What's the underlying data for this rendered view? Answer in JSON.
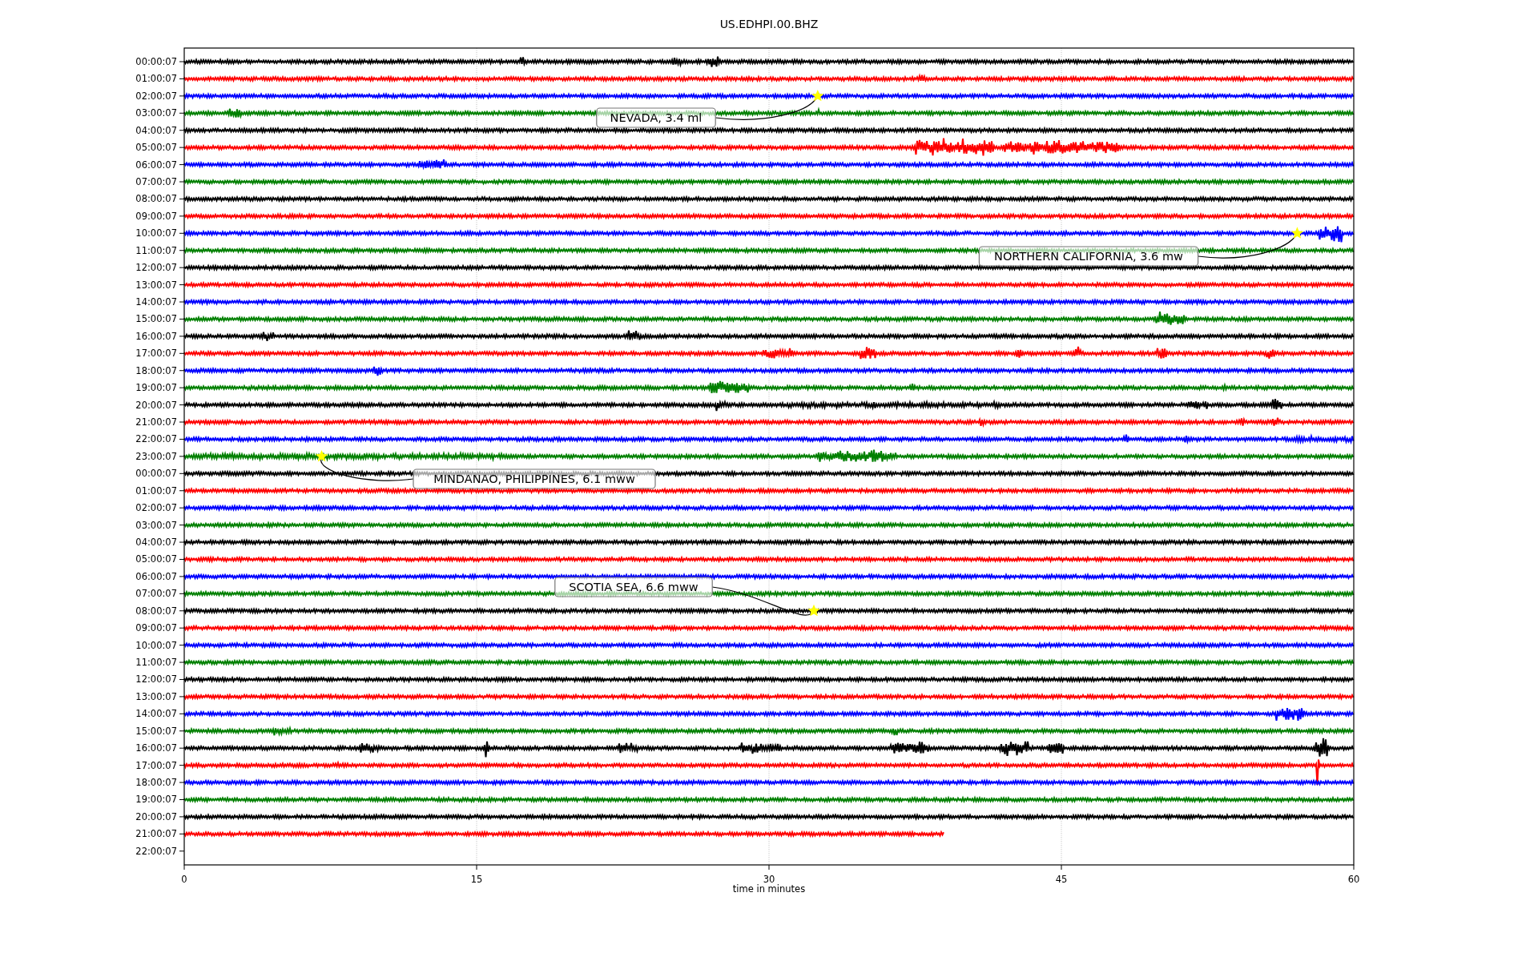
{
  "title": "US.EDHPI.00.BHZ",
  "rows": [
    {
      "label": "00:00:07",
      "color": "#000000",
      "level": 1
    },
    {
      "label": "01:00:07",
      "color": "#ff0000",
      "level": 1
    },
    {
      "label": "02:00:07",
      "color": "#0000ff",
      "level": 1,
      "event": {
        "label": "NEVADA, 3.4 ml"
      }
    },
    {
      "label": "03:00:07",
      "color": "#008000",
      "level": 1
    },
    {
      "label": "04:00:07",
      "color": "#000000",
      "level": 1
    },
    {
      "label": "05:00:07",
      "color": "#ff0000",
      "level": 1
    },
    {
      "label": "06:00:07",
      "color": "#0000ff",
      "level": 1
    },
    {
      "label": "07:00:07",
      "color": "#008000",
      "level": 1
    },
    {
      "label": "08:00:07",
      "color": "#000000",
      "level": 1
    },
    {
      "label": "09:00:07",
      "color": "#ff0000",
      "level": 1
    },
    {
      "label": "10:00:07",
      "color": "#0000ff",
      "level": 1,
      "event": {
        "label": "NORTHERN CALIFORNIA, 3.6 mw"
      }
    },
    {
      "label": "11:00:07",
      "color": "#008000",
      "level": 1
    },
    {
      "label": "12:00:07",
      "color": "#000000",
      "level": 1
    },
    {
      "label": "13:00:07",
      "color": "#ff0000",
      "level": 1
    },
    {
      "label": "14:00:07",
      "color": "#0000ff",
      "level": 1
    },
    {
      "label": "15:00:07",
      "color": "#008000",
      "level": 1
    },
    {
      "label": "16:00:07",
      "color": "#000000",
      "level": 1
    },
    {
      "label": "17:00:07",
      "color": "#ff0000",
      "level": 1
    },
    {
      "label": "18:00:07",
      "color": "#0000ff",
      "level": 1
    },
    {
      "label": "19:00:07",
      "color": "#008000",
      "level": 1
    },
    {
      "label": "20:00:07",
      "color": "#000000",
      "level": 1
    },
    {
      "label": "21:00:07",
      "color": "#ff0000",
      "level": 1
    },
    {
      "label": "22:00:07",
      "color": "#0000ff",
      "level": 1
    },
    {
      "label": "23:00:07",
      "color": "#008000",
      "level": 1,
      "event": {
        "label": "MINDANAO, PHILIPPINES, 6.1 mww"
      }
    },
    {
      "label": "00:00:07",
      "color": "#000000",
      "level": 1
    },
    {
      "label": "01:00:07",
      "color": "#ff0000",
      "level": 1
    },
    {
      "label": "02:00:07",
      "color": "#0000ff",
      "level": 1
    },
    {
      "label": "03:00:07",
      "color": "#008000",
      "level": 1
    },
    {
      "label": "04:00:07",
      "color": "#000000",
      "level": 1
    },
    {
      "label": "05:00:07",
      "color": "#ff0000",
      "level": 1
    },
    {
      "label": "06:00:07",
      "color": "#0000ff",
      "level": 1
    },
    {
      "label": "07:00:07",
      "color": "#008000",
      "level": 1
    },
    {
      "label": "08:00:07",
      "color": "#000000",
      "level": 1,
      "event": {
        "label": "SCOTIA SEA, 6.6 mww"
      }
    },
    {
      "label": "09:00:07",
      "color": "#ff0000",
      "level": 1
    },
    {
      "label": "10:00:07",
      "color": "#0000ff",
      "level": 1
    },
    {
      "label": "11:00:07",
      "color": "#008000",
      "level": 1
    },
    {
      "label": "12:00:07",
      "color": "#000000",
      "level": 1
    },
    {
      "label": "13:00:07",
      "color": "#ff0000",
      "level": 1
    },
    {
      "label": "14:00:07",
      "color": "#0000ff",
      "level": 1
    },
    {
      "label": "15:00:07",
      "color": "#008000",
      "level": 1
    },
    {
      "label": "16:00:07",
      "color": "#000000",
      "level": 1
    },
    {
      "label": "17:00:07",
      "color": "#ff0000",
      "level": 1
    },
    {
      "label": "18:00:07",
      "color": "#0000ff",
      "level": 1
    },
    {
      "label": "19:00:07",
      "color": "#008000",
      "level": 1
    },
    {
      "label": "20:00:07",
      "color": "#000000",
      "level": 1
    },
    {
      "label": "21:00:07",
      "color": "#ff0000",
      "level": 0.65
    },
    {
      "label": "22:00:07"
    }
  ],
  "x_axis": {
    "ticks": [
      "0",
      "15",
      "30",
      "45",
      "60"
    ],
    "label": "time in minutes"
  }
}
